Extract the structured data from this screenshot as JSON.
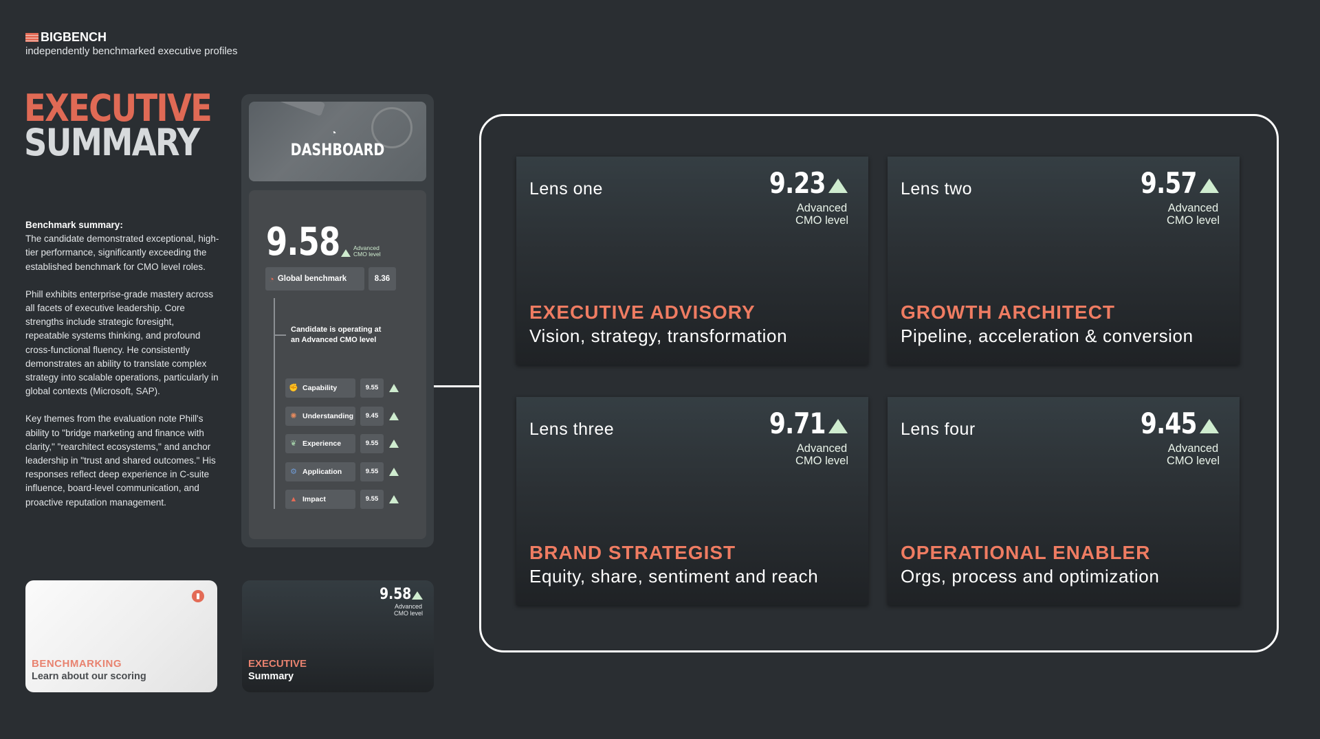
{
  "header": {
    "brand": "BIGBENCH",
    "tagline": "independently benchmarked executive profiles"
  },
  "title": {
    "line1": "EXECUTIVE",
    "line2": "SUMMARY"
  },
  "summary": {
    "label": "Benchmark summary:",
    "p1": "The candidate demonstrated exceptional, high-tier performance, significantly exceeding the established benchmark for CMO level roles.",
    "p2": "Phill exhibits enterprise-grade mastery across all facets of executive leadership. Core strengths include strategic foresight, repeatable systems thinking, and profound cross-functional fluency. He consistently demonstrates an ability to translate complex strategy into scalable operations, particularly in global contexts (Microsoft, SAP).",
    "p3": "Key themes from the evaluation note Phill's ability to \"bridge marketing and finance with clarity,\" \"rearchitect ecosystems,\" and anchor leadership in \"trust and shared outcomes.\" His responses reflect deep experience in C-suite influence, board-level communication, and proactive reputation management."
  },
  "cards": {
    "benchmarking": {
      "title": "BENCHMARKING",
      "subtitle": "Learn about our scoring"
    },
    "executive": {
      "title": "EXECUTIVE",
      "subtitle": "Summary",
      "score": "9.58",
      "level": "Advanced CMO level"
    }
  },
  "dashboard": {
    "hero_label": "DASHBOARD",
    "score": "9.58",
    "level_line1": "Advanced",
    "level_line2": "CMO level",
    "global_label": "Global benchmark",
    "global_value": "8.36",
    "candidate_line1": "Candidate is operating at",
    "candidate_line2": "an Advanced CMO level",
    "metrics": [
      {
        "label": "Capability",
        "value": "9.55",
        "icon": "arm-icon",
        "color": "#7a9aa8"
      },
      {
        "label": "Understanding",
        "value": "9.45",
        "icon": "brain-icon",
        "color": "#e58a5e"
      },
      {
        "label": "Experience",
        "value": "9.55",
        "icon": "sprout-icon",
        "color": "#9fc9a4"
      },
      {
        "label": "Application",
        "value": "9.55",
        "icon": "gear-icon",
        "color": "#6f9bd6"
      },
      {
        "label": "Impact",
        "value": "9.55",
        "icon": "flame-icon",
        "color": "#e36b56"
      }
    ]
  },
  "lenses": [
    {
      "name": "Lens one",
      "score": "9.23",
      "level_line1": "Advanced",
      "level_line2": "CMO level",
      "category": "EXECUTIVE ADVISORY",
      "subtitle": "Vision, strategy, transformation"
    },
    {
      "name": "Lens two",
      "score": "9.57",
      "level_line1": "Advanced",
      "level_line2": "CMO level",
      "category": "GROWTH ARCHITECT",
      "subtitle": "Pipeline, acceleration & conversion"
    },
    {
      "name": "Lens three",
      "score": "9.71",
      "level_line1": "Advanced",
      "level_line2": "CMO level",
      "category": "BRAND STRATEGIST",
      "subtitle": "Equity, share, sentiment and reach"
    },
    {
      "name": "Lens four",
      "score": "9.45",
      "level_line1": "Advanced",
      "level_line2": "CMO level",
      "category": "OPERATIONAL ENABLER",
      "subtitle": "Orgs, process and optimization"
    }
  ],
  "colors": {
    "accent": "#e36b56",
    "up": "#cfeccf",
    "background": "#2a2e32"
  }
}
